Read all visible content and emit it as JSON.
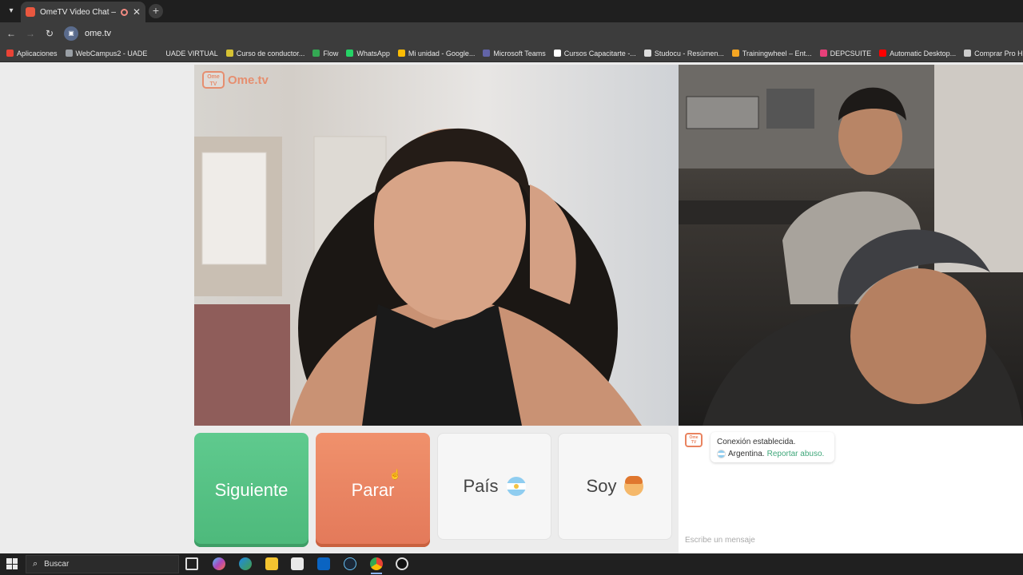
{
  "browser": {
    "tab_title": "OmeTV Video Chat — Ome",
    "tab_close": "✕",
    "new_tab": "+",
    "url": "ome.tv"
  },
  "bookmarks": [
    {
      "label": "Aplicaciones",
      "icon": "apps-icon",
      "color": "#e94335"
    },
    {
      "label": "WebCampus2 - UADE",
      "icon": "globe-icon",
      "color": "#9aa0a6"
    },
    {
      "label": "UADE VIRTUAL",
      "icon": "blank-icon",
      "color": "#3c3c3c"
    },
    {
      "label": "Curso de conductor...",
      "icon": "folder-icon",
      "color": "#d6c233"
    },
    {
      "label": "Flow",
      "icon": "flow-icon",
      "color": "#34a853"
    },
    {
      "label": "WhatsApp",
      "icon": "whatsapp-icon",
      "color": "#25d366"
    },
    {
      "label": "Mi unidad - Google...",
      "icon": "drive-icon",
      "color": "#fbbc04"
    },
    {
      "label": "Microsoft Teams",
      "icon": "teams-icon",
      "color": "#6264a7"
    },
    {
      "label": "Cursos Capacitarte -...",
      "icon": "c-icon",
      "color": "#ffffff"
    },
    {
      "label": "Studocu - Resúmen...",
      "icon": "studocu-icon",
      "color": "#dddddd"
    },
    {
      "label": "Trainingwheel – Ent...",
      "icon": "trainingwheel-icon",
      "color": "#f5a623"
    },
    {
      "label": "DEPCSUITE",
      "icon": "depc-icon",
      "color": "#e8407a"
    },
    {
      "label": "Automatic Desktop...",
      "icon": "youtube-icon",
      "color": "#ff0000"
    },
    {
      "label": "Comprar Pro Horm...",
      "icon": "shop-icon",
      "color": "#cccccc"
    }
  ],
  "app": {
    "brand": "Ome.tv",
    "logo_small": "Ome TV"
  },
  "buttons": {
    "next": "Siguiente",
    "stop": "Parar",
    "country": "País",
    "gender": "Soy"
  },
  "chat": {
    "status_line1": "Conexión establecida.",
    "country": "Argentina.",
    "report_link": "Reportar abuso.",
    "input_placeholder": "Escribe un mensaje"
  },
  "taskbar": {
    "search_label": "Buscar"
  },
  "colors": {
    "next_green": "#5fca8e",
    "stop_orange": "#f0916c",
    "report_green": "#3fa77a",
    "brand_orange": "#e9835f"
  }
}
